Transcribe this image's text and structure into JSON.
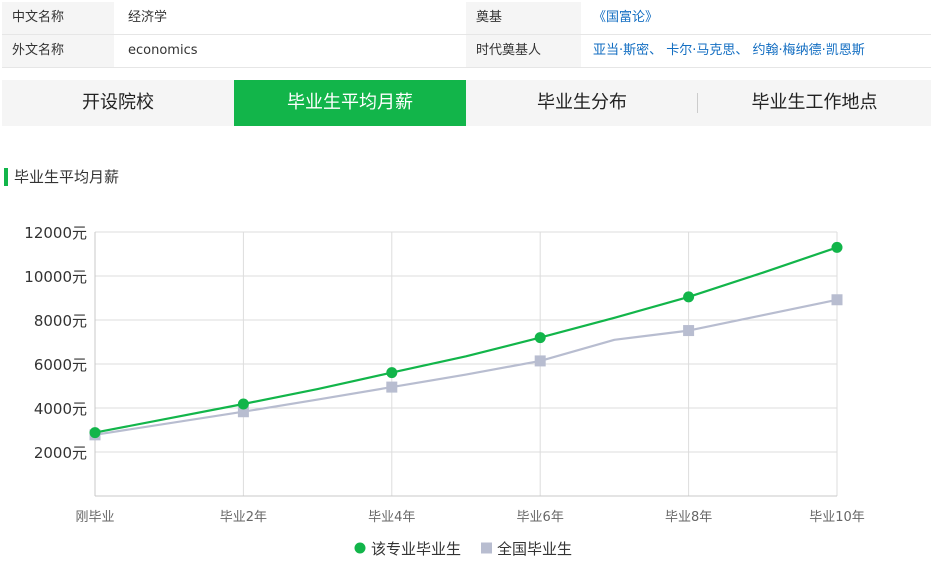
{
  "info": {
    "row1": {
      "key_left": "中文名称",
      "value_left": "经济学",
      "key_right": "奠基",
      "value_right": "《国富论》"
    },
    "row2": {
      "key_left": "外文名称",
      "value_left": "economics",
      "key_right": "时代奠基人",
      "value_right": "亚当·斯密、 卡尔·马克思、 约翰·梅纳德·凯恩斯"
    }
  },
  "tabs": [
    {
      "label": "开设院校",
      "active": false
    },
    {
      "label": "毕业生平均月薪",
      "active": true
    },
    {
      "label": "毕业生分布",
      "active": false
    },
    {
      "label": "毕业生工作地点",
      "active": false
    }
  ],
  "section_title": "毕业生平均月薪",
  "colors": {
    "accent": "#12b54a",
    "series_major": "#12b54a",
    "series_national": "#b8bdd0",
    "grid": "#dddddd",
    "link": "#136ec2"
  },
  "chart_data": {
    "type": "line",
    "x": [
      "刚毕业",
      "毕业2年",
      "毕业4年",
      "毕业6年",
      "毕业8年",
      "毕业10年"
    ],
    "x_positions": [
      0,
      2,
      4,
      6,
      8,
      10
    ],
    "ylim": [
      0,
      12000
    ],
    "y_ticks": [
      2000,
      4000,
      6000,
      8000,
      10000,
      12000
    ],
    "y_tick_suffix": "元",
    "grid": true,
    "legend_position": "bottom-center",
    "series": [
      {
        "name": "该专业毕业生",
        "marker": "circle",
        "x": [
          0,
          2,
          3,
          4,
          5,
          6,
          7,
          8,
          9,
          10
        ],
        "values": [
          2880,
          4180,
          4860,
          5610,
          6350,
          7200,
          8100,
          9050,
          10150,
          11300
        ],
        "marker_indices": [
          0,
          1,
          3,
          5,
          7,
          9
        ]
      },
      {
        "name": "全国毕业生",
        "marker": "square",
        "x": [
          0,
          2,
          3,
          4,
          5,
          6,
          7,
          8,
          9,
          10
        ],
        "values": [
          2780,
          3830,
          4380,
          4950,
          5520,
          6140,
          7100,
          7520,
          8220,
          8920
        ],
        "marker_indices": [
          0,
          1,
          3,
          5,
          7,
          9
        ]
      }
    ]
  }
}
